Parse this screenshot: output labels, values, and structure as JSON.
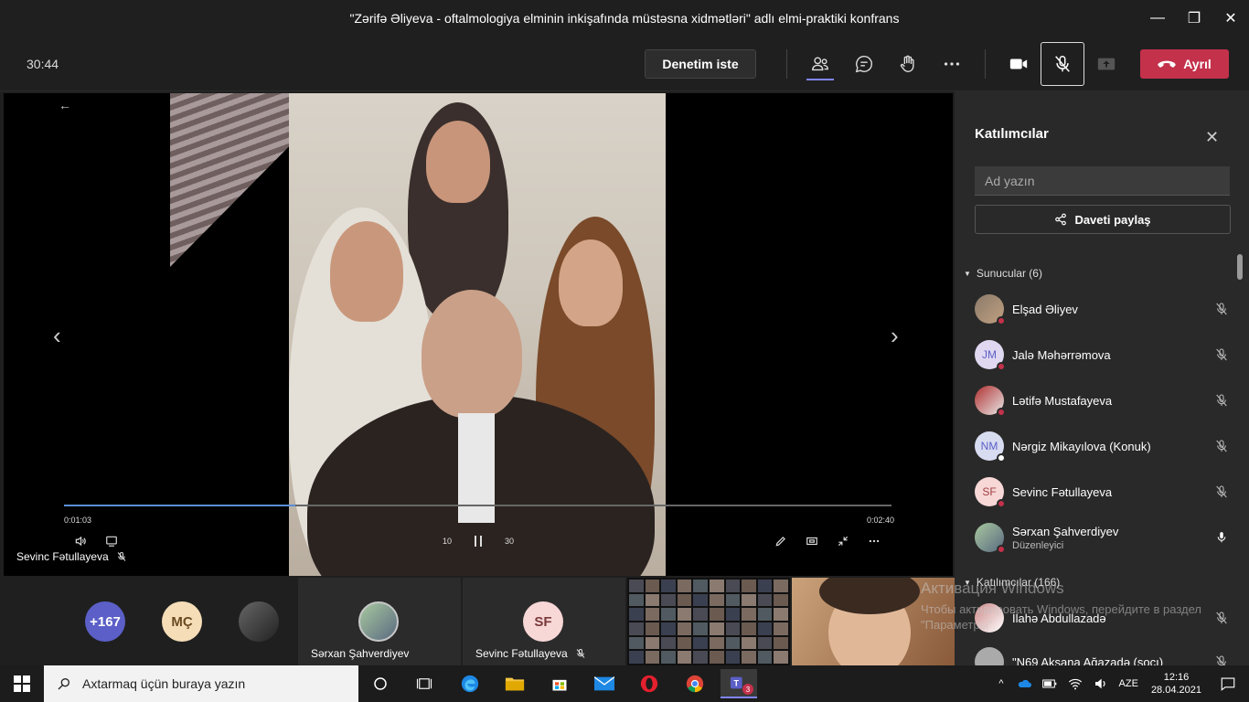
{
  "window": {
    "title": "\"Zərifə Əliyeva - oftalmologiya elminin inkişafında müstəsna xidmətləri\" adlı elmi-praktiki konfrans",
    "minimize": "—",
    "maximize": "❐",
    "close": "✕"
  },
  "toolbar": {
    "timer": "30:44",
    "review_label": "Denetim iste",
    "leave_label": "Ayrıl"
  },
  "stage": {
    "back": "←",
    "prev": "‹",
    "next": "›",
    "elapsed": "0:01:03",
    "duration": "0:02:40",
    "progress": 0.28,
    "rewind_label": "10",
    "forward_label": "30",
    "presenter": "Sevinc Fətullayeva"
  },
  "panel": {
    "title": "Katılımcılar",
    "search_placeholder": "Ad yazın",
    "invite_label": "Daveti paylaş",
    "presenters_head": "Sunucular (6)",
    "attendees_head": "Katılımcılar (166)",
    "presenters": [
      {
        "name": "Elşad Əliyev",
        "initials": "",
        "sub": ""
      },
      {
        "name": "Jalə Məhərrəmova",
        "initials": "JM",
        "sub": ""
      },
      {
        "name": "Lətifə Mustafayeva",
        "initials": "",
        "sub": ""
      },
      {
        "name": "Nərgiz Mikayılova (Konuk)",
        "initials": "NM",
        "sub": ""
      },
      {
        "name": "Sevinc Fətullayeva",
        "initials": "SF",
        "sub": ""
      },
      {
        "name": "Sərxan Şahverdiyev",
        "initials": "",
        "sub": "Düzenleyici"
      }
    ],
    "attendees": [
      {
        "name": "İlahə Abdullazadə",
        "initials": ""
      },
      {
        "name": "\"N69 Aksana Ağazadə (soçı)",
        "initials": ""
      }
    ]
  },
  "watermark": {
    "title": "Активация Windows",
    "text": "Чтобы активировать Windows, перейдите в раздел \"Параметры\"."
  },
  "strip": {
    "more_count": "+167",
    "mc_initials": "MÇ",
    "tile1_name": "Sərxan Şahverdiyev",
    "tile2_initials": "SF",
    "tile2_name": "Sevinc Fətullayeva"
  },
  "taskbar": {
    "search_placeholder": "Axtarmaq üçün buraya yazın",
    "lang": "AZE",
    "time": "12:16",
    "date": "28.04.2021",
    "teams_badge": "3"
  },
  "colors": {
    "leave": "#c4314b",
    "accent": "#7f85f5",
    "progress": "#5a8fd6"
  }
}
